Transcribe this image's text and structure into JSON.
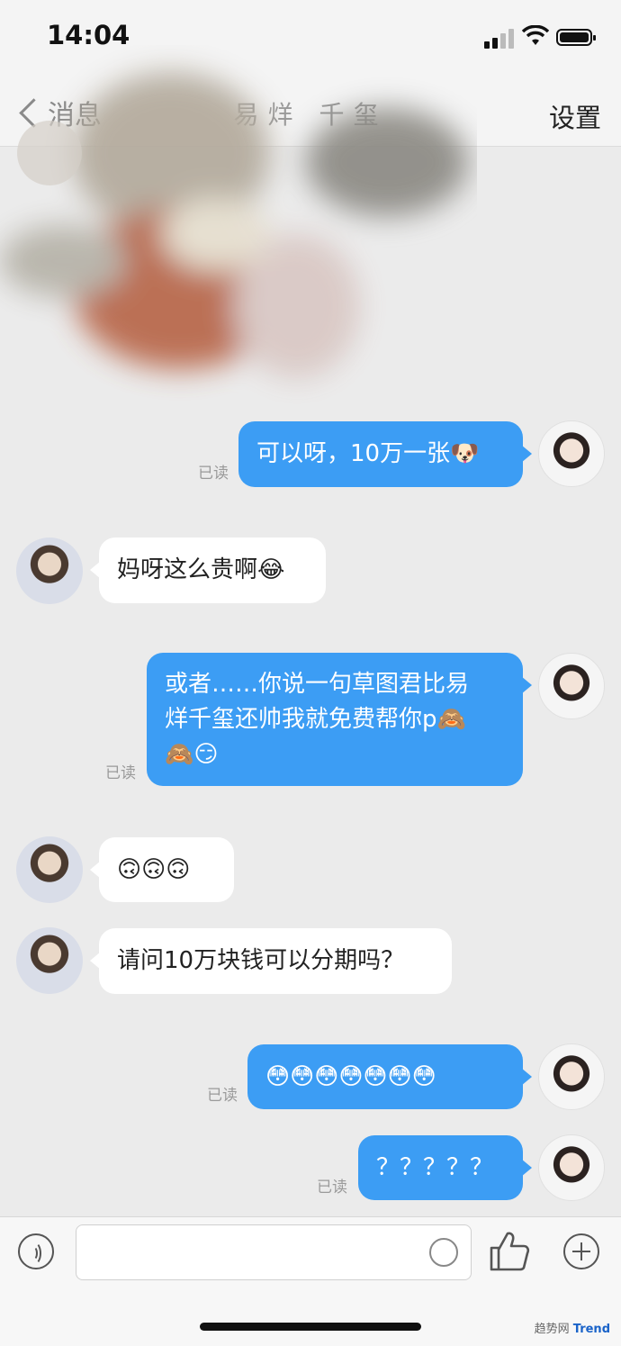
{
  "status_bar": {
    "time": "14:04"
  },
  "nav": {
    "back_label": "消息",
    "title": "易烊 千玺",
    "settings_label": "设置"
  },
  "messages": [
    {
      "side": "out",
      "text": "可以呀，10万一张🐶",
      "read": "已读"
    },
    {
      "side": "in",
      "text": "妈呀这么贵啊😂"
    },
    {
      "side": "out",
      "text": "或者……你说一句草图君比易\n烊千玺还帅我就免费帮你p🙈\n🙈😏",
      "read": "已读"
    },
    {
      "side": "in",
      "text": "🙃🙃🙃"
    },
    {
      "side": "in",
      "text": "请问10万块钱可以分期吗？"
    },
    {
      "side": "out",
      "text": "😳😳😳😳😳😳😳",
      "read": "已读"
    },
    {
      "side": "out",
      "text": "？？？？？",
      "read": "已读"
    }
  ],
  "input_bar": {
    "placeholder": ""
  },
  "watermark": {
    "prefix": "趋势网",
    "brand": "Trend"
  },
  "colors": {
    "bubble_out": "#3c9df4",
    "bubble_in": "#ffffff",
    "background": "#ebebeb"
  }
}
